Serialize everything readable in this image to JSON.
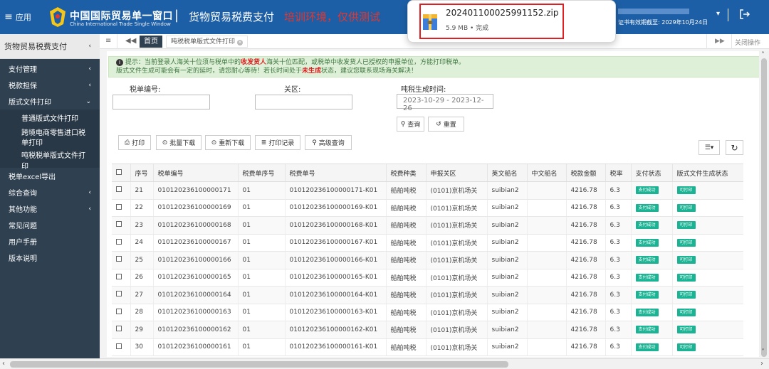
{
  "header": {
    "menu_label": "应用",
    "brand_cn": "中国国际贸易单一窗口",
    "brand_en": "China International Trade Single Window",
    "separator": "|",
    "app_title": "货物贸易税费支付",
    "training_tag": "培训环境，仅供测试",
    "expiry_text": "证书有效期截至: 2029年10月24日",
    "user_caret": "▾"
  },
  "download": {
    "filename": "20240110002599115​2.zip",
    "meta": "5.9 MB • 完成"
  },
  "sidebar": {
    "title": "货物贸易税费支付",
    "items": [
      {
        "label": "支付管理",
        "caret": "‹"
      },
      {
        "label": "税款担保",
        "caret": "‹"
      },
      {
        "label": "版式文件打印",
        "caret": "⌄"
      },
      {
        "label": "普通版式文件打印"
      },
      {
        "label": "跨境电商零售进口税单打印"
      },
      {
        "label": "吨税税单版式文件打印"
      },
      {
        "label": "税单excel导出"
      },
      {
        "label": "综合查询",
        "caret": "‹"
      },
      {
        "label": "其他功能",
        "caret": "‹"
      },
      {
        "label": "常见问题"
      },
      {
        "label": "用户手册"
      },
      {
        "label": "版本说明"
      }
    ]
  },
  "tabs": {
    "home": "首页",
    "current": "吨税税单版式文件打印",
    "close_ops": "关闭操作"
  },
  "notice": {
    "line1_a": "提示：当前登录人海关十位须与税单中的",
    "line1_red": "收发货人",
    "line1_b": "海关十位匹配，或税单中收发货人已授权的申报单位，方能打印税单。",
    "line2_a": "版式文件生成可能会有一定的延时，请您耐心等待！若长时间处于",
    "line2_red": "未生成",
    "line2_b": "状态，建议您联系现场海关解决！"
  },
  "filters": {
    "tax_no_label": "税单编号:",
    "customs_label": "关区:",
    "date_label": "吨税生成时间:",
    "date_value": "2023-10-29 - 2023-12-26",
    "query": "查询",
    "reset": "重置"
  },
  "toolbar": {
    "print": "打印",
    "batch_download": "批量下载",
    "redownload": "重新下载",
    "print_log": "打印记录",
    "advanced": "高级查询"
  },
  "table": {
    "columns": [
      "序号",
      "税单编号",
      "税费单序号",
      "税费单号",
      "税费种类",
      "申报关区",
      "英文船名",
      "中文船名",
      "税款金额",
      "税率",
      "支付状态",
      "版式文件生成状态"
    ],
    "rows": [
      [
        "21",
        "010120236100000171",
        "01",
        "010120236100000171-K01",
        "船舶吨税",
        "(0101)京机场关",
        "suibian2",
        "",
        "4216.78",
        "6.3",
        "支付成功",
        "可打印"
      ],
      [
        "22",
        "010120236100000169",
        "01",
        "010120236100000169-K01",
        "船舶吨税",
        "(0101)京机场关",
        "suibian2",
        "",
        "4216.78",
        "6.3",
        "支付成功",
        "可打印"
      ],
      [
        "23",
        "010120236100000168",
        "01",
        "010120236100000168-K01",
        "船舶吨税",
        "(0101)京机场关",
        "suibian2",
        "",
        "4216.78",
        "6.3",
        "支付成功",
        "可打印"
      ],
      [
        "24",
        "010120236100000167",
        "01",
        "010120236100000167-K01",
        "船舶吨税",
        "(0101)京机场关",
        "suibian2",
        "",
        "4216.78",
        "6.3",
        "支付成功",
        "可打印"
      ],
      [
        "25",
        "010120236100000166",
        "01",
        "010120236100000166-K01",
        "船舶吨税",
        "(0101)京机场关",
        "suibian2",
        "",
        "4216.78",
        "6.3",
        "支付成功",
        "可打印"
      ],
      [
        "26",
        "010120236100000165",
        "01",
        "010120236100000165-K01",
        "船舶吨税",
        "(0101)京机场关",
        "suibian2",
        "",
        "4216.78",
        "6.3",
        "支付成功",
        "可打印"
      ],
      [
        "27",
        "010120236100000164",
        "01",
        "010120236100000164-K01",
        "船舶吨税",
        "(0101)京机场关",
        "suibian2",
        "",
        "4216.78",
        "6.3",
        "支付成功",
        "可打印"
      ],
      [
        "28",
        "010120236100000163",
        "01",
        "010120236100000163-K01",
        "船舶吨税",
        "(0101)京机场关",
        "suibian2",
        "",
        "4216.78",
        "6.3",
        "支付成功",
        "可打印"
      ],
      [
        "29",
        "010120236100000162",
        "01",
        "010120236100000162-K01",
        "船舶吨税",
        "(0101)京机场关",
        "suibian2",
        "",
        "4216.78",
        "6.3",
        "支付成功",
        "可打印"
      ],
      [
        "30",
        "010120236100000161",
        "01",
        "010120236100000161-K01",
        "船舶吨税",
        "(0101)京机场关",
        "suibian2",
        "",
        "4216.78",
        "6.3",
        "支付成功",
        "可打印"
      ]
    ]
  },
  "icons": {
    "menu": "hamburger-icon",
    "logo": "customs-emblem-icon",
    "logout": "logout-icon",
    "zip": "zip-file-icon",
    "info": "info-icon",
    "print": "print-icon",
    "download": "download-icon",
    "log": "list-icon",
    "search": "search-icon",
    "reset": "undo-icon",
    "columns": "columns-icon",
    "refresh": "refresh-icon"
  },
  "colors": {
    "topbar": "#1d5fa6",
    "sidebar": "#2f4050",
    "status_tag": "#1ab394",
    "notice_bg": "#dff0d8",
    "training_red": "#e7352b"
  }
}
